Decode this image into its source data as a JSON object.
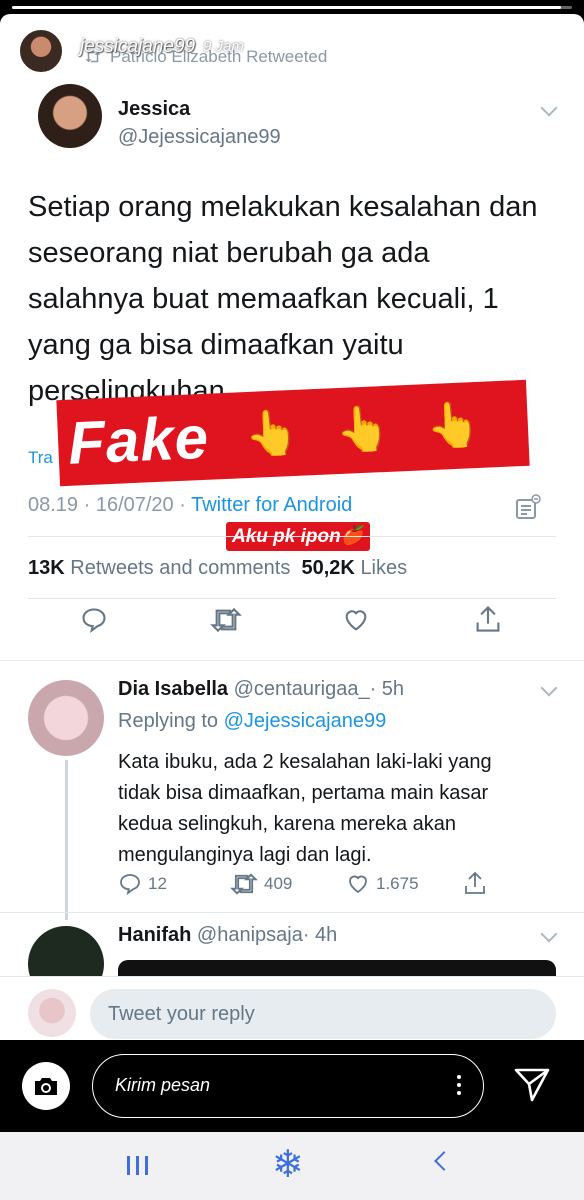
{
  "story": {
    "username": "jessicajane99",
    "time": "9 Jam",
    "progress": 0.98,
    "message_placeholder": "Kirim pesan"
  },
  "retweet": {
    "label": "Patricio Elizabeth Retweeted"
  },
  "tweet": {
    "name": "Jessica",
    "handle": "@Jejessicajane99",
    "text": "Setiap orang melakukan kesalahan dan seseorang niat berubah ga ada salahnya buat memaafkan kecuali, 1 yang ga bisa dimaafkan yaitu perselingkuhan.",
    "translate": "Tra",
    "time_date": "08.19 · 16/07/20 · ",
    "source": "Twitter for Android",
    "retweets_count": "13K",
    "retweets_label": "Retweets and comments",
    "likes_count": "50,2K",
    "likes_label": "Likes"
  },
  "overlay": {
    "fake_label": "Fake",
    "hand_emoji": "👆",
    "sticker_text": "Aku pk ipon🍎"
  },
  "replies": [
    {
      "name": "Dia Isabella",
      "handle": "@centaurigaa_",
      "age": "· 5h",
      "replying_prefix": "Replying to",
      "replying_to": "@Jejessicajane99",
      "text": "Kata ibuku, ada 2 kesalahan laki-laki yang tidak bisa dimaafkan, pertama main kasar kedua selingkuh, karena mereka akan mengulanginya lagi dan lagi.",
      "reply_count": "12",
      "retweet_count": "409",
      "like_count": "1.675"
    },
    {
      "name": "Hanifah",
      "handle": "@hanipsaja",
      "age": "· 4h"
    }
  ],
  "reply_bar": {
    "placeholder": "Tweet your reply"
  },
  "colors": {
    "twitter_blue": "#1b95e0",
    "fake_red": "#e0141e",
    "nav_blue": "#3f6fd8"
  }
}
